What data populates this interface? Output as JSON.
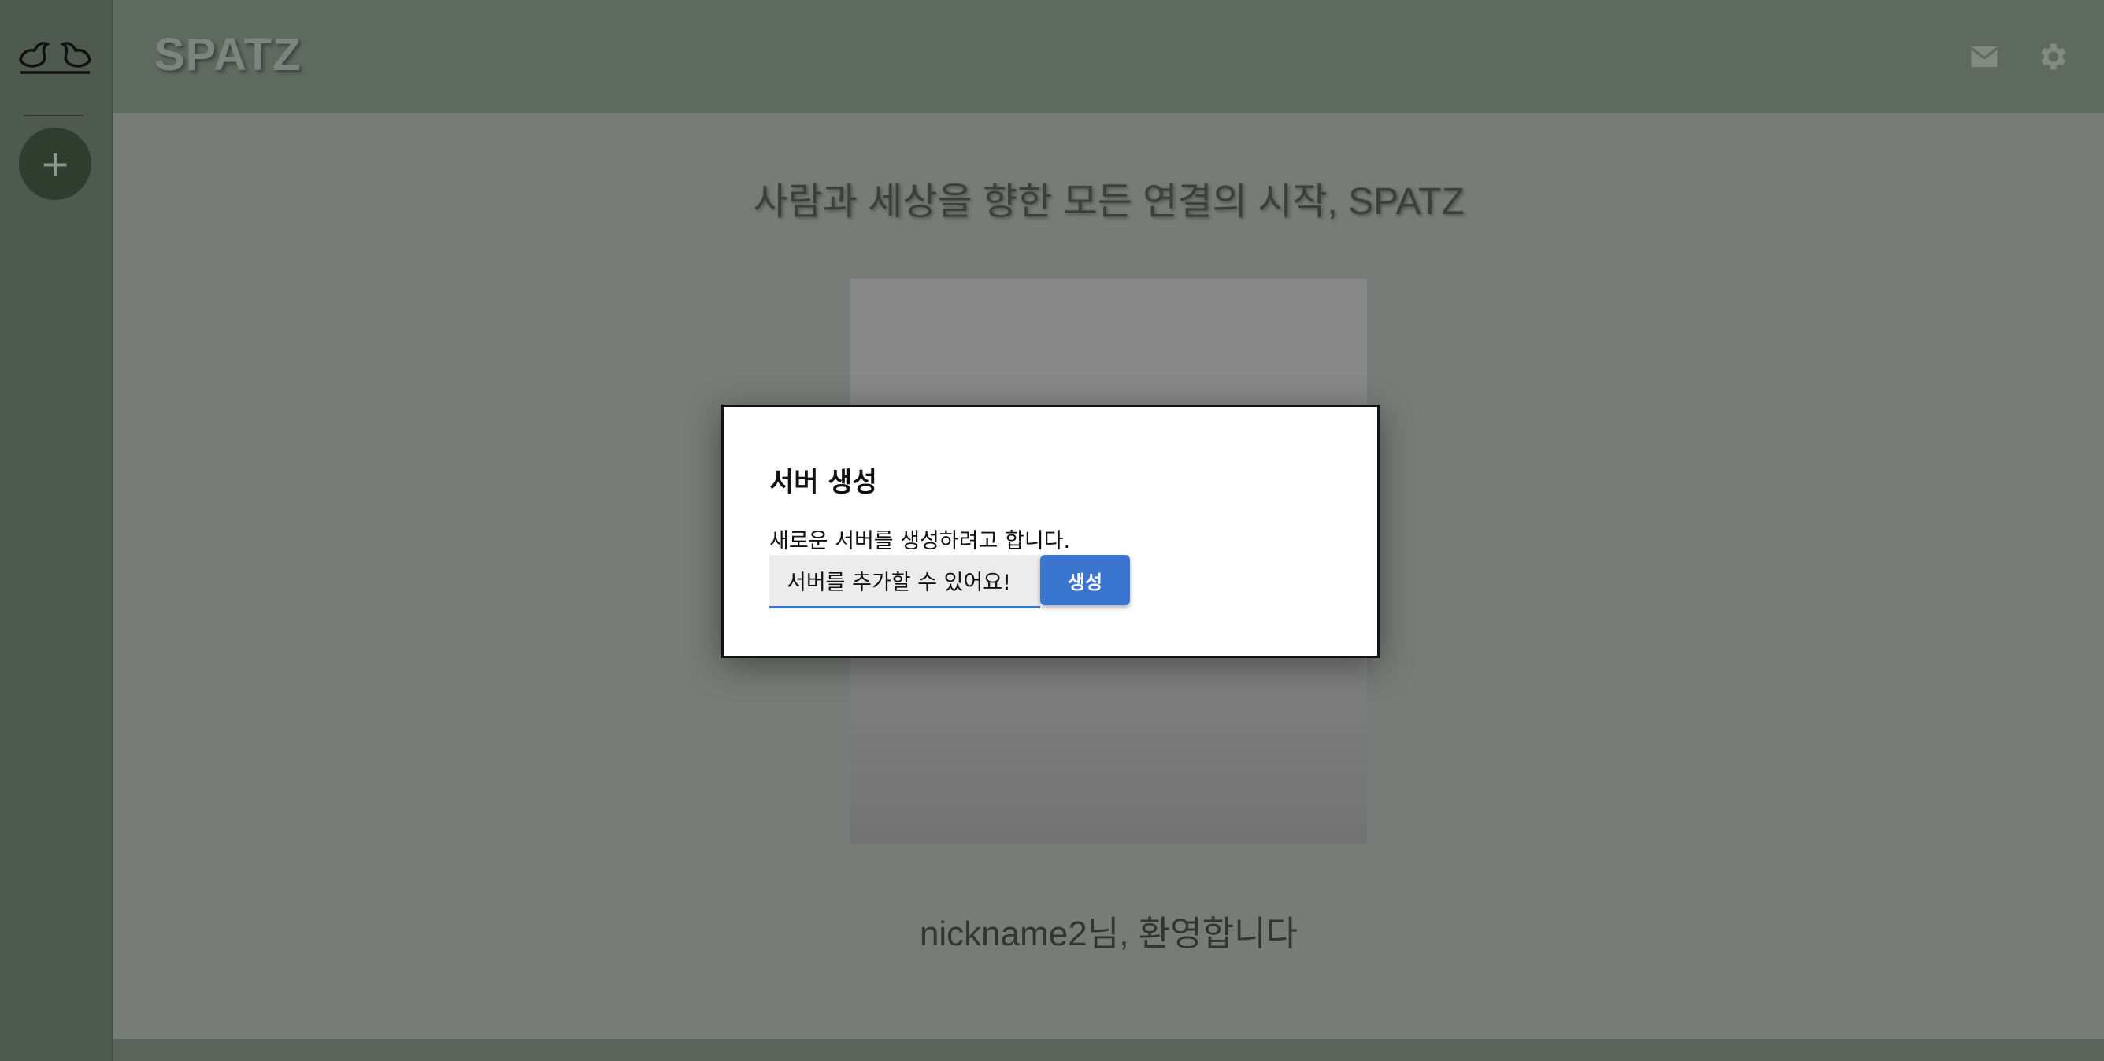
{
  "sidebar": {
    "logo_icon": "twin-birds-logo-icon",
    "add_button_label": "+"
  },
  "header": {
    "brand": "SPATZ",
    "icons": [
      "mail-icon",
      "gear-icon"
    ]
  },
  "main": {
    "tagline": "사람과 세상을 향한 모든 연결의 시작, SPATZ",
    "welcome": "nickname2님, 환영합니다"
  },
  "dialog": {
    "title": "서버 생성",
    "description": "새로운 서버를 생성하려고 합니다.",
    "input_value": "서버를 추가할 수 있어요!",
    "create_label": "생성"
  },
  "colors": {
    "sidebar": "#4e5a4e",
    "header": "#5e6960",
    "accent": "#3a76d0"
  }
}
